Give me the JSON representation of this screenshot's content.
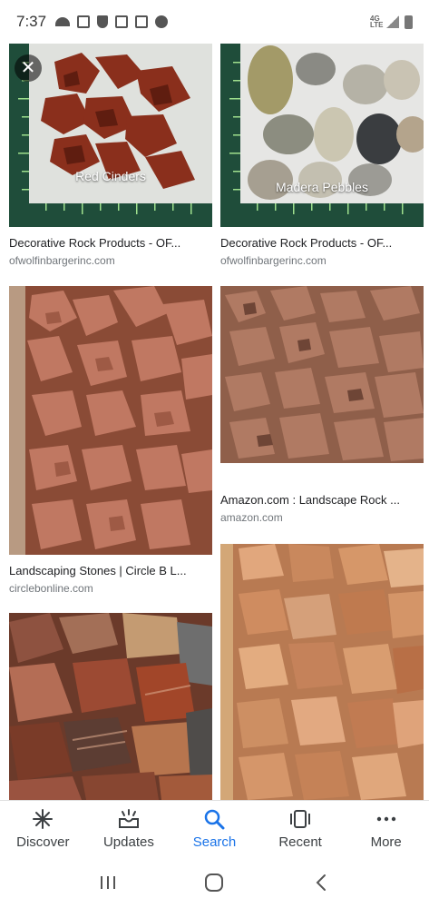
{
  "status_bar": {
    "time": "7:37"
  },
  "results": [
    {
      "caption": "Decorative Rock Products - OF...",
      "source": "ofwolfinbargerinc.com",
      "overlay_label": "Red Cinders"
    },
    {
      "caption": "Decorative Rock Products - OF...",
      "source": "ofwolfinbargerinc.com",
      "overlay_label": "Madera Pebbles"
    },
    {
      "caption": "Landscaping Stones | Circle B L...",
      "source": "circlebonline.com"
    },
    {
      "caption": "Amazon.com : Landscape Rock ...",
      "source": "amazon.com"
    },
    {
      "caption": "",
      "source": ""
    },
    {
      "caption": "",
      "source": ""
    }
  ],
  "bottom_nav": {
    "items": [
      {
        "label": "Discover",
        "icon": "asterisk-icon"
      },
      {
        "label": "Updates",
        "icon": "inbox-icon"
      },
      {
        "label": "Search",
        "icon": "search-icon",
        "active": true
      },
      {
        "label": "Recent",
        "icon": "recent-cards-icon"
      },
      {
        "label": "More",
        "icon": "more-dots-icon"
      }
    ]
  },
  "colors": {
    "accent": "#1a73e8",
    "text": "#202124",
    "secondary_text": "#70757a"
  }
}
